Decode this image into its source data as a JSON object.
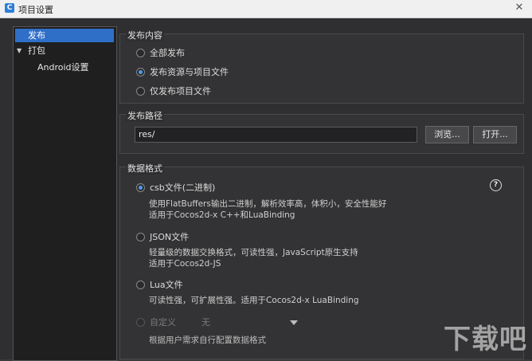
{
  "window": {
    "title": "项目设置",
    "close_glyph": "✕"
  },
  "sidebar": {
    "items": [
      {
        "label": "发布"
      },
      {
        "label": "打包",
        "expand_glyph": "▼"
      },
      {
        "label": "Android设置"
      }
    ]
  },
  "publish_content": {
    "title": "发布内容",
    "options": [
      {
        "label": "全部发布",
        "checked": false
      },
      {
        "label": "发布资源与项目文件",
        "checked": true
      },
      {
        "label": "仅发布项目文件",
        "checked": false
      }
    ]
  },
  "publish_path": {
    "title": "发布路径",
    "value": "res/",
    "browse_label": "浏览...",
    "open_label": "打开..."
  },
  "data_format": {
    "title": "数据格式",
    "help_glyph": "?",
    "options": [
      {
        "label": "csb文件(二进制)",
        "checked": true,
        "desc1": "使用FlatBuffers输出二进制，解析效率高，体积小，安全性能好",
        "desc2": "适用于Cocos2d-x C++和LuaBinding"
      },
      {
        "label": "JSON文件",
        "checked": false,
        "desc1": "轻量级的数据交换格式，可读性强，JavaScript原生支持",
        "desc2": "适用于Cocos2d-JS"
      },
      {
        "label": "Lua文件",
        "checked": false,
        "desc1": "可读性强，可扩展性强。适用于Cocos2d-x LuaBinding"
      },
      {
        "label": "自定义",
        "checked": false,
        "disabled": true,
        "combo_value": "无",
        "desc1": "根据用户需求自行配置数据格式"
      }
    ]
  },
  "watermark": "下载吧"
}
